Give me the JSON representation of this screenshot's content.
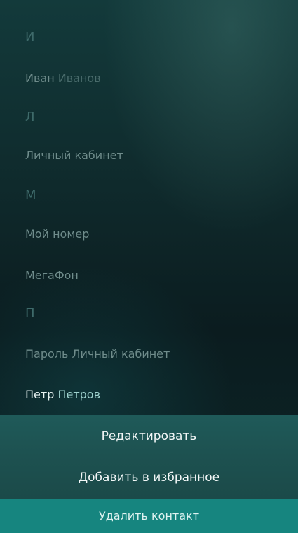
{
  "contacts": {
    "sections": [
      {
        "letter": "И",
        "items": [
          {
            "first": "Иван",
            "last": "Иванов"
          }
        ]
      },
      {
        "letter": "Л",
        "items": [
          {
            "text": "Личный кабинет"
          }
        ]
      },
      {
        "letter": "М",
        "items": [
          {
            "text": "Мой номер"
          },
          {
            "text": "МегаФон"
          }
        ]
      },
      {
        "letter": "П",
        "items": [
          {
            "text": "Пароль Личный кабинет"
          },
          {
            "first": "Петр",
            "last": "Петров"
          }
        ]
      }
    ]
  },
  "context_menu": {
    "edit_label": "Редактировать",
    "favorite_label": "Добавить в избранное",
    "delete_label": "Удалить контакт"
  },
  "colors": {
    "menu_background": "#1f5a59",
    "delete_background": "#16857f",
    "highlight_text": "#e8f3f2"
  }
}
